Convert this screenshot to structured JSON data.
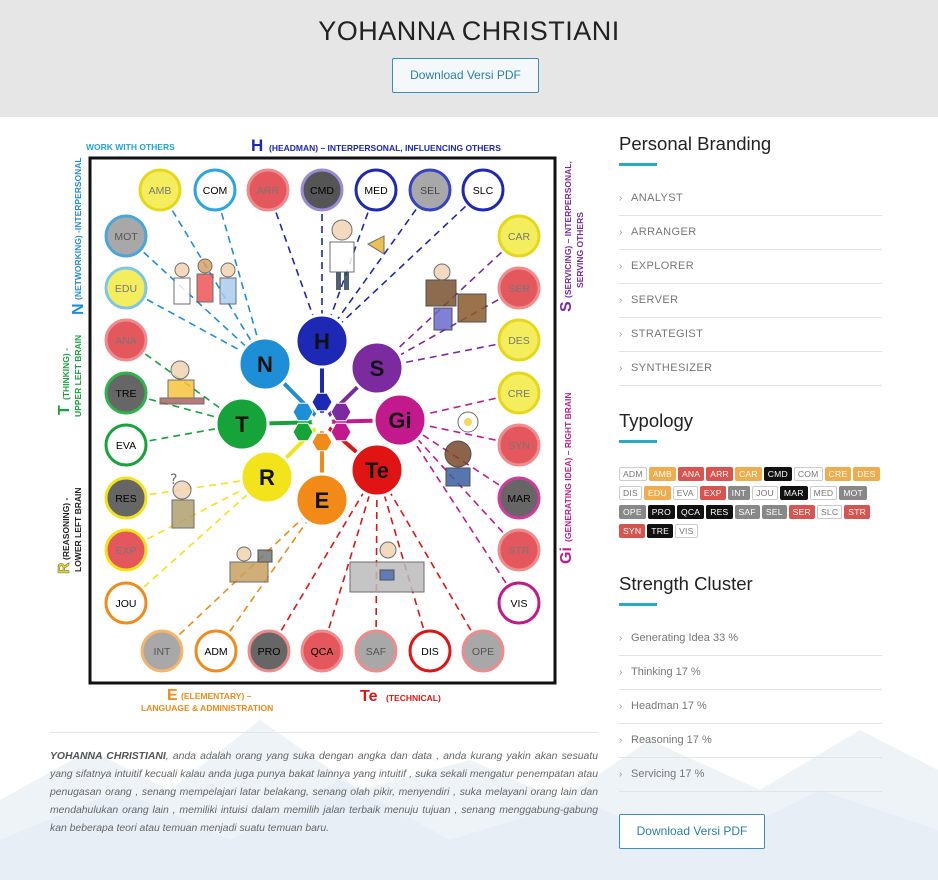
{
  "header": {
    "title": "YOHANNA CHRISTIANI",
    "pdf_button": "Download Versi PDF"
  },
  "diagram": {
    "top_title": {
      "letter": "H",
      "text": "(HEADMAN) – INTERPERSONAL, INFLUENCING OTHERS"
    },
    "work_with_others": "WORK WITH OTHERS",
    "left_n": {
      "letter": "N",
      "text": "(NETWORKING) -INTERPERSONAL"
    },
    "left_t": {
      "letter": "T",
      "text1": "(THINKING) -",
      "text2": "UPPER LEFT BRAIN"
    },
    "left_r": {
      "letter": "R",
      "text1": "(REASONING) -",
      "text2": "LOWER LEFT BRAIN"
    },
    "right_s": {
      "letter": "S",
      "text1": "(SERVICING) – INTERPERSONAL,",
      "text2": "SERVING OTHERS"
    },
    "right_gi": {
      "letter": "Gi",
      "text": "(GENERATING IDEA) – RIGHT BRAIN"
    },
    "bottom_e": {
      "letter": "E",
      "text1": "(ELEMENTARY) –",
      "text2": "LANGUAGE & ADMINISTRATION"
    },
    "bottom_te": {
      "letter": "Te",
      "text": "(TECHNICAL)"
    },
    "clusters": [
      {
        "label": "H",
        "color": "#1d28b4"
      },
      {
        "label": "S",
        "color": "#7b2aa0"
      },
      {
        "label": "N",
        "color": "#1e8fd6"
      },
      {
        "label": "Gi",
        "color": "#c21a8c"
      },
      {
        "label": "T",
        "color": "#16a33a"
      },
      {
        "label": "Te",
        "color": "#e11414"
      },
      {
        "label": "R",
        "color": "#f3e31b"
      },
      {
        "label": "E",
        "color": "#f18a16"
      }
    ],
    "talents": [
      {
        "code": "AMB",
        "fill": "#f4ee5f",
        "ring": "#e6d818",
        "text": "#777",
        "group": "N"
      },
      {
        "code": "COM",
        "fill": "#ffffff",
        "ring": "#29a6dd",
        "text": "#000",
        "group": "N"
      },
      {
        "code": "ARR",
        "fill": "#e4575c",
        "ring": "#ef8b8d",
        "text": "#777",
        "group": "H"
      },
      {
        "code": "CMD",
        "fill": "#555555",
        "ring": "#9b8bd6",
        "text": "#000",
        "group": "H"
      },
      {
        "code": "MED",
        "fill": "#ffffff",
        "ring": "#1d28b4",
        "text": "#000",
        "group": "H"
      },
      {
        "code": "SEL",
        "fill": "#a8a8a8",
        "ring": "#3944c0",
        "text": "#444",
        "group": "H"
      },
      {
        "code": "SLC",
        "fill": "#ffffff",
        "ring": "#1d28b4",
        "text": "#000",
        "group": "H"
      },
      {
        "code": "MOT",
        "fill": "#a8a8a8",
        "ring": "#4aa6d8",
        "text": "#555",
        "group": "N"
      },
      {
        "code": "EDU",
        "fill": "#f4ee5f",
        "ring": "#7ec6e8",
        "text": "#777",
        "group": "N"
      },
      {
        "code": "ANA",
        "fill": "#e4575c",
        "ring": "#ef8b8d",
        "text": "#777",
        "group": "T"
      },
      {
        "code": "TRE",
        "fill": "#666666",
        "ring": "#2fb34d",
        "text": "#000",
        "group": "T"
      },
      {
        "code": "EVA",
        "fill": "#ffffff",
        "ring": "#16a33a",
        "text": "#000",
        "group": "T"
      },
      {
        "code": "RES",
        "fill": "#666666",
        "ring": "#f3e31b",
        "text": "#000",
        "group": "R"
      },
      {
        "code": "EXP",
        "fill": "#e4575c",
        "ring": "#f3e31b",
        "text": "#777",
        "group": "R"
      },
      {
        "code": "JOU",
        "fill": "#ffffff",
        "ring": "#f18a16",
        "text": "#000",
        "group": "R"
      },
      {
        "code": "CAR",
        "fill": "#f4ee5f",
        "ring": "#e6d818",
        "text": "#777",
        "group": "S"
      },
      {
        "code": "SER",
        "fill": "#e4575c",
        "ring": "#ef8b8d",
        "text": "#777",
        "group": "S"
      },
      {
        "code": "DES",
        "fill": "#f4ee5f",
        "ring": "#e6d818",
        "text": "#777",
        "group": "S"
      },
      {
        "code": "CRE",
        "fill": "#f4ee5f",
        "ring": "#e6d818",
        "text": "#777",
        "group": "Gi"
      },
      {
        "code": "SYN",
        "fill": "#e4575c",
        "ring": "#ef8b8d",
        "text": "#777",
        "group": "Gi"
      },
      {
        "code": "MAR",
        "fill": "#666666",
        "ring": "#d23a9e",
        "text": "#000",
        "group": "Gi"
      },
      {
        "code": "STR",
        "fill": "#e4575c",
        "ring": "#ef8b8d",
        "text": "#777",
        "group": "Gi"
      },
      {
        "code": "VIS",
        "fill": "#ffffff",
        "ring": "#c21a8c",
        "text": "#000",
        "group": "Gi"
      },
      {
        "code": "INT",
        "fill": "#a8a8a8",
        "ring": "#f5b56b",
        "text": "#555",
        "group": "E"
      },
      {
        "code": "ADM",
        "fill": "#ffffff",
        "ring": "#f18a16",
        "text": "#000",
        "group": "E"
      },
      {
        "code": "PRO",
        "fill": "#666666",
        "ring": "#ef8b8d",
        "text": "#000",
        "group": "Te"
      },
      {
        "code": "QCA",
        "fill": "#e4575c",
        "ring": "#ef8b8d",
        "text": "#000",
        "group": "Te"
      },
      {
        "code": "SAF",
        "fill": "#a8a8a8",
        "ring": "#ef8b8d",
        "text": "#555",
        "group": "Te"
      },
      {
        "code": "DIS",
        "fill": "#ffffff",
        "ring": "#e11414",
        "text": "#000",
        "group": "Te"
      },
      {
        "code": "OPE",
        "fill": "#a8a8a8",
        "ring": "#ef8b8d",
        "text": "#555",
        "group": "Te"
      }
    ]
  },
  "description": {
    "name": "YOHANNA CHRISTIANI",
    "text": ", anda adalah orang yang suka dengan angka dan data , anda kurang yakin akan sesuatu yang sifatnya intuitif kecuali kalau anda juga punya bakat lainnya yang intuitif , suka sekali mengatur penempatan atau penugasan orang , senang mempelajari latar belakang, senang olah pikir, menyendiri , suka melayani orang lain dan mendahulukan orang lain , memiliki intuisi dalam memilih jalan terbaik menuju tujuan , senang menggabung-gabung kan beberapa teori atau temuan menjadi suatu temuan baru."
  },
  "sidebar": {
    "personal_branding": {
      "title": "Personal Branding",
      "items": [
        "ANALYST",
        "ARRANGER",
        "EXPLORER",
        "SERVER",
        "STRATEGIST",
        "SYNTHESIZER"
      ]
    },
    "typology": {
      "title": "Typology",
      "tags": [
        {
          "code": "ADM",
          "bg": "#ffffff",
          "fg": "#777",
          "border": "#ccc"
        },
        {
          "code": "AMB",
          "bg": "#f0ad4e",
          "fg": "#fff",
          "border": "#f0ad4e"
        },
        {
          "code": "ANA",
          "bg": "#d9534f",
          "fg": "#fff",
          "border": "#d9534f"
        },
        {
          "code": "ARR",
          "bg": "#d9534f",
          "fg": "#fff",
          "border": "#d9534f"
        },
        {
          "code": "CAR",
          "bg": "#f0ad4e",
          "fg": "#fff",
          "border": "#f0ad4e"
        },
        {
          "code": "CMD",
          "bg": "#111111",
          "fg": "#fff",
          "border": "#111"
        },
        {
          "code": "COM",
          "bg": "#ffffff",
          "fg": "#777",
          "border": "#ccc"
        },
        {
          "code": "CRE",
          "bg": "#f0ad4e",
          "fg": "#fff",
          "border": "#f0ad4e"
        },
        {
          "code": "DES",
          "bg": "#f0ad4e",
          "fg": "#fff",
          "border": "#f0ad4e"
        },
        {
          "code": "DIS",
          "bg": "#ffffff",
          "fg": "#777",
          "border": "#ccc"
        },
        {
          "code": "EDU",
          "bg": "#f0ad4e",
          "fg": "#fff",
          "border": "#f0ad4e"
        },
        {
          "code": "EVA",
          "bg": "#ffffff",
          "fg": "#777",
          "border": "#ccc"
        },
        {
          "code": "EXP",
          "bg": "#d9534f",
          "fg": "#fff",
          "border": "#d9534f"
        },
        {
          "code": "INT",
          "bg": "#888888",
          "fg": "#fff",
          "border": "#888"
        },
        {
          "code": "JOU",
          "bg": "#ffffff",
          "fg": "#777",
          "border": "#ccc"
        },
        {
          "code": "MAR",
          "bg": "#111111",
          "fg": "#fff",
          "border": "#111"
        },
        {
          "code": "MED",
          "bg": "#ffffff",
          "fg": "#777",
          "border": "#ccc"
        },
        {
          "code": "MOT",
          "bg": "#888888",
          "fg": "#fff",
          "border": "#888"
        },
        {
          "code": "OPE",
          "bg": "#888888",
          "fg": "#fff",
          "border": "#888"
        },
        {
          "code": "PRO",
          "bg": "#111111",
          "fg": "#fff",
          "border": "#111"
        },
        {
          "code": "QCA",
          "bg": "#111111",
          "fg": "#fff",
          "border": "#111"
        },
        {
          "code": "RES",
          "bg": "#111111",
          "fg": "#fff",
          "border": "#111"
        },
        {
          "code": "SAF",
          "bg": "#888888",
          "fg": "#fff",
          "border": "#888"
        },
        {
          "code": "SEL",
          "bg": "#888888",
          "fg": "#fff",
          "border": "#888"
        },
        {
          "code": "SER",
          "bg": "#d9534f",
          "fg": "#fff",
          "border": "#d9534f"
        },
        {
          "code": "SLC",
          "bg": "#ffffff",
          "fg": "#777",
          "border": "#ccc"
        },
        {
          "code": "STR",
          "bg": "#d9534f",
          "fg": "#fff",
          "border": "#d9534f"
        },
        {
          "code": "SYN",
          "bg": "#d9534f",
          "fg": "#fff",
          "border": "#d9534f"
        },
        {
          "code": "TRE",
          "bg": "#111111",
          "fg": "#fff",
          "border": "#111"
        },
        {
          "code": "VIS",
          "bg": "#ffffff",
          "fg": "#777",
          "border": "#ccc"
        }
      ]
    },
    "strength_cluster": {
      "title": "Strength Cluster",
      "items": [
        "Generating Idea 33 %",
        "Thinking 17 %",
        "Headman 17 %",
        "Reasoning 17 %",
        "Servicing 17 %"
      ]
    },
    "pdf_button": "Download Versi PDF"
  },
  "colors": {
    "accent": "#2aa8c8",
    "button_border": "#3a8fb7",
    "header_bg": "#e6e6e6"
  }
}
